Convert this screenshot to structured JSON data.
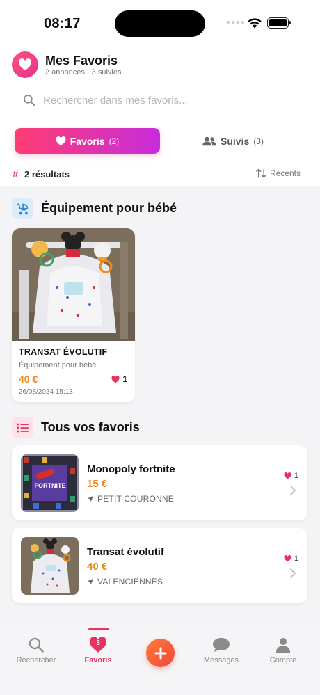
{
  "status": {
    "time": "08:17"
  },
  "header": {
    "title": "Mes Favoris",
    "subtitle": "2 annonces · 3 suivies"
  },
  "search": {
    "placeholder": "Rechercher dans mes favoris..."
  },
  "tabs": [
    {
      "label": "Favoris",
      "count": "(2)",
      "active": true
    },
    {
      "label": "Suivis",
      "count": "(3)",
      "active": false
    }
  ],
  "results": {
    "hash": "#",
    "count_label": "2 résultats",
    "sort_label": "Récents"
  },
  "sections": {
    "category": {
      "title": "Équipement pour bébé",
      "icon": "baby-carriage-icon"
    },
    "all": {
      "title": "Tous vos favoris",
      "icon": "list-icon"
    }
  },
  "featured": {
    "name": "TRANSAT ÉVOLUTIF",
    "category": "Équipement pour bébé",
    "price": "40 €",
    "likes": "1",
    "date": "26/08/2024 15:13"
  },
  "favorites": [
    {
      "title": "Monopoly fortnite",
      "price": "15 €",
      "location": "PETIT COURONNE",
      "likes": "1"
    },
    {
      "title": "Transat évolutif",
      "price": "40 €",
      "location": "VALENCIENNES",
      "likes": "1"
    }
  ],
  "nav": {
    "items": [
      {
        "label": "Rechercher",
        "icon": "search-icon"
      },
      {
        "label": "Favoris",
        "icon": "heart-icon",
        "badge": "3",
        "active": true
      },
      {
        "label": "Messages",
        "icon": "chat-bubble-icon"
      },
      {
        "label": "Compte",
        "icon": "person-icon"
      }
    ],
    "fab_icon": "plus-icon"
  },
  "colors": {
    "accent": "#e8335f",
    "price": "#f08a1c",
    "gradient_start": "#ff3d72",
    "gradient_end": "#c72cdc",
    "fab": "#f5603a"
  }
}
